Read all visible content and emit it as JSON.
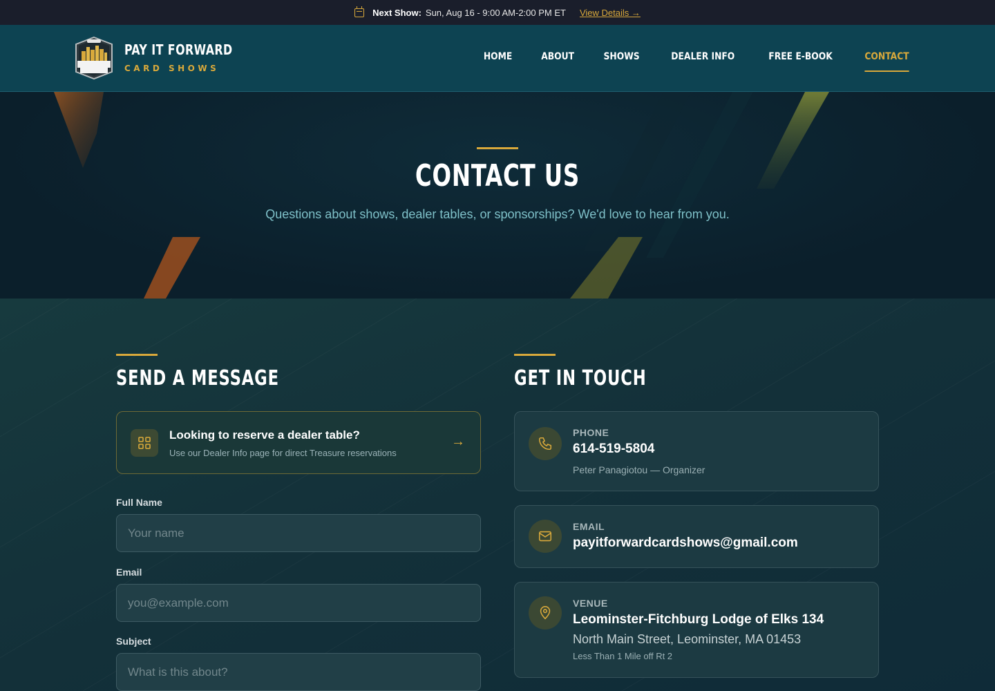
{
  "topbar": {
    "label": "Next Show:",
    "details": "Sun, Aug 16 - 9:00 AM-2:00 PM ET",
    "link": "View Details →"
  },
  "brand": {
    "name": "PAY IT FORWARD",
    "tagline": "CARD SHOWS",
    "logo_text": "PAY IT FORWARD CARD SHOW",
    "logo_badge": "EST. 2021"
  },
  "nav": {
    "items": [
      "HOME",
      "ABOUT",
      "SHOWS",
      "DEALER INFO",
      "FREE E-BOOK",
      "CONTACT"
    ],
    "active": "CONTACT"
  },
  "hero": {
    "title": "CONTACT US",
    "subtitle": "Questions about shows, dealer tables, or sponsorships? We'd love to hear from you."
  },
  "form": {
    "title": "SEND A MESSAGE",
    "notice": {
      "title": "Looking to reserve a dealer table?",
      "text": "Use our Dealer Info page for direct Treasure reservations"
    },
    "fields": [
      {
        "label": "Full Name",
        "placeholder": "Your name"
      },
      {
        "label": "Email",
        "placeholder": "you@example.com"
      },
      {
        "label": "Subject",
        "placeholder": "What is this about?"
      }
    ]
  },
  "contact": {
    "title": "GET IN TOUCH",
    "phone": {
      "label": "PHONE",
      "value": "614-519-5804",
      "note": "Peter Panagiotou — Organizer"
    },
    "email": {
      "label": "EMAIL",
      "value": "payitforwardcardshows@gmail.com"
    },
    "venue": {
      "label": "VENUE",
      "name": "Leominster-Fitchburg Lodge of Elks 134",
      "address": "North Main Street, Leominster, MA 01453",
      "note": "Less Than 1 Mile off Rt 2"
    }
  },
  "colors": {
    "accent": "#d9a93b",
    "header": "#0d4352",
    "topbar": "#1a1e2b"
  }
}
